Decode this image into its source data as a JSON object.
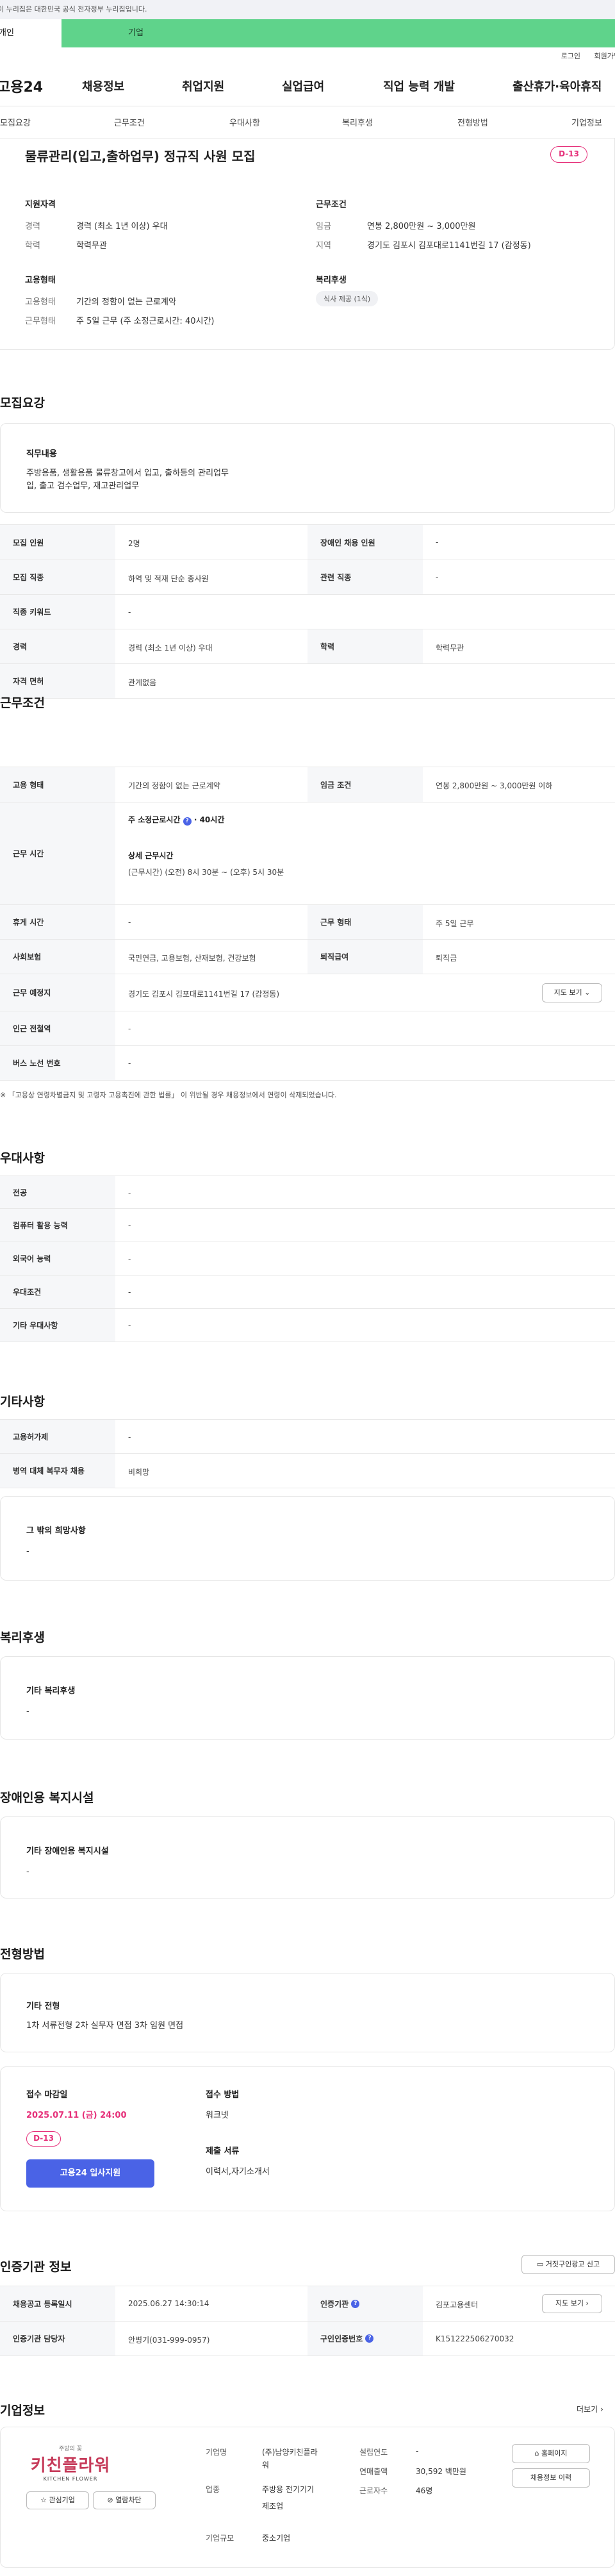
{
  "gov_notice": "이 누리집은 대한민국 공식 전자정부 누리집입니다.",
  "site_tabs": {
    "individual": "개인",
    "company": "기업"
  },
  "utility": {
    "login": "로그인",
    "signup": "회원가입"
  },
  "logo": "고용24",
  "main_nav": [
    "채용정보",
    "취업지원",
    "실업급여",
    "직업 능력 개발",
    "출산휴가·육아휴직"
  ],
  "sub_nav": [
    "모집요강",
    "근무조건",
    "우대사항",
    "복리후생",
    "전형방법",
    "기업정보"
  ],
  "job": {
    "title": "물류관리(입고,출하업무) 정규직 사원 모집",
    "dday": "D-13",
    "qualify_title": "지원자격",
    "career_k": "경력",
    "career_v": "경력 (최소 1년 이상) 우대",
    "edu_k": "학력",
    "edu_v": "학력무관",
    "employ_title": "고용형태",
    "emptype_k": "고용형태",
    "emptype_v": "기간의 정함이 없는 근로계약",
    "workform_k": "근무형태",
    "workform_v": "주 5일 근무 (주 소정근로시간: 40시간)",
    "cond_title": "근무조건",
    "wage_k": "임금",
    "wage_v": "연봉 2,800만원 ~ 3,000만원",
    "region_k": "지역",
    "region_v": "경기도 김포시 김포대로1141번길 17 (감정동)",
    "welfare_title": "복리후생",
    "welfare_pill": "식사 제공 (1식)"
  },
  "recruit": {
    "title": "모집요강",
    "duty_h": "직무내용",
    "duty_t1": "주방용품, 생활용품 물류창고에서 입고, 출하등의 관리업무",
    "duty_t2": "입, 출고 검수업무, 재고관리업무",
    "rows": [
      {
        "l1": "모집 인원",
        "v1": "2명",
        "l2": "장애인 채용 인원",
        "v2": "-"
      },
      {
        "l1": "모집 직종",
        "v1": "하역 및 적재 단순 종사원",
        "l2": "관련 직종",
        "v2": "-"
      },
      {
        "l1": "직종 키워드",
        "v1": "-"
      },
      {
        "l1": "경력",
        "v1": "경력 (최소 1년 이상) 우대",
        "l2": "학력",
        "v2": "학력무관"
      },
      {
        "l1": "자격 면허",
        "v1": "관계없음"
      }
    ]
  },
  "work": {
    "title": "근무조건",
    "r1": {
      "l1": "고용 형태",
      "v1": "기간의 정함이 없는 근로계약",
      "l2": "임금 조건",
      "v2": "연봉 2,800만원 ~ 3,000만원 이하"
    },
    "r2": {
      "l": "근무 시간",
      "a": "주 소정근로시간",
      "a2": "40시간",
      "b": "상세 근무시간",
      "c": "(근무시간) (오전) 8시 30분 ~ (오후) 5시 30분"
    },
    "r3": {
      "l1": "휴게 시간",
      "v1": "-",
      "l2": "근무 형태",
      "v2": "주 5일 근무"
    },
    "r4": {
      "l1": "사회보험",
      "v1": "국민연금, 고용보험, 산재보험, 건강보험",
      "l2": "퇴직급여",
      "v2": "퇴직금"
    },
    "r5": {
      "l": "근무 예정지",
      "v": "경기도 김포시 김포대로1141번길 17 (감정동)",
      "btn": "지도 보기"
    },
    "r6": {
      "l": "인근 전철역",
      "v": "-"
    },
    "r7": {
      "l": "버스 노선 번호",
      "v": "-"
    },
    "note": "※ 「고용상 연령차별금지 및 고령자 고용촉진에 관한 법률」 이 위반될 경우 채용정보에서 연령이 삭제되었습니다."
  },
  "pref": {
    "title": "우대사항",
    "rows": [
      {
        "l": "전공",
        "v": "-"
      },
      {
        "l": "컴퓨터 활용 능력",
        "v": "-"
      },
      {
        "l": "외국어 능력",
        "v": "-"
      },
      {
        "l": "우대조건",
        "v": "-"
      },
      {
        "l": "기타 우대사항",
        "v": "-"
      }
    ]
  },
  "etc": {
    "title": "기타사항",
    "rows": [
      {
        "l": "고용허가제",
        "v": "-"
      },
      {
        "l": "병역 대체 복무자 채용",
        "v": "비희망"
      }
    ],
    "hope_h": "그 밖의 희망사항",
    "hope_v": "-"
  },
  "welfare": {
    "title": "복리후생",
    "h": "기타 복리후생",
    "v": "-"
  },
  "disabled": {
    "title": "장애인용 복지시설",
    "h": "기타 장애인용 복지시설",
    "v": "-"
  },
  "select": {
    "title": "전형방법",
    "h": "기타 전형",
    "v": "1차 서류전형 2차 실무자 면접 3차 임원 면접",
    "deadline_h": "접수 마감일",
    "deadline": "2025.07.11 (금) 24:00",
    "dday": "D-13",
    "apply": "고용24 입사지원",
    "method_h": "접수 방법",
    "method_v": "워크넷",
    "docs_h": "제출 서류",
    "docs_v": "이력서,자기소개서"
  },
  "agency": {
    "title": "인증기관 정보",
    "report_btn": "거짓구인광고 신고",
    "r1": {
      "l1": "채용공고 등록일시",
      "v1": "2025.06.27 14:30:14",
      "l2": "인증기관",
      "v2": "김포고용센터",
      "btn": "지도 보기"
    },
    "r2": {
      "l1": "인증기관 담당자",
      "v1": "안병기(031-999-0957)",
      "l2": "구인인증번호",
      "v2": "K151222506270032"
    }
  },
  "company": {
    "title": "기업정보",
    "more": "더보기",
    "logo_small": "주방의 꽃",
    "logo_main": "키친플라워",
    "logo_en": "KITCHEN FLOWER",
    "fav_btn": "관심기업",
    "block_btn": "열람차단",
    "name_l": "기업명",
    "name_v1": "(주)남양키친플라",
    "name_v2": "워",
    "ind_l": "업종",
    "ind_v1": "주방용 전기기기",
    "ind_v2": "제조업",
    "size_l": "기업규모",
    "size_v": "중소기업",
    "est_l": "설립연도",
    "est_v": "-",
    "sales_l": "연매출액",
    "sales_v": "30,592 백만원",
    "emp_l": "근로자수",
    "emp_v": "46명",
    "home_btn": "홈페이지",
    "jobs_btn": "채용정보 이력"
  }
}
